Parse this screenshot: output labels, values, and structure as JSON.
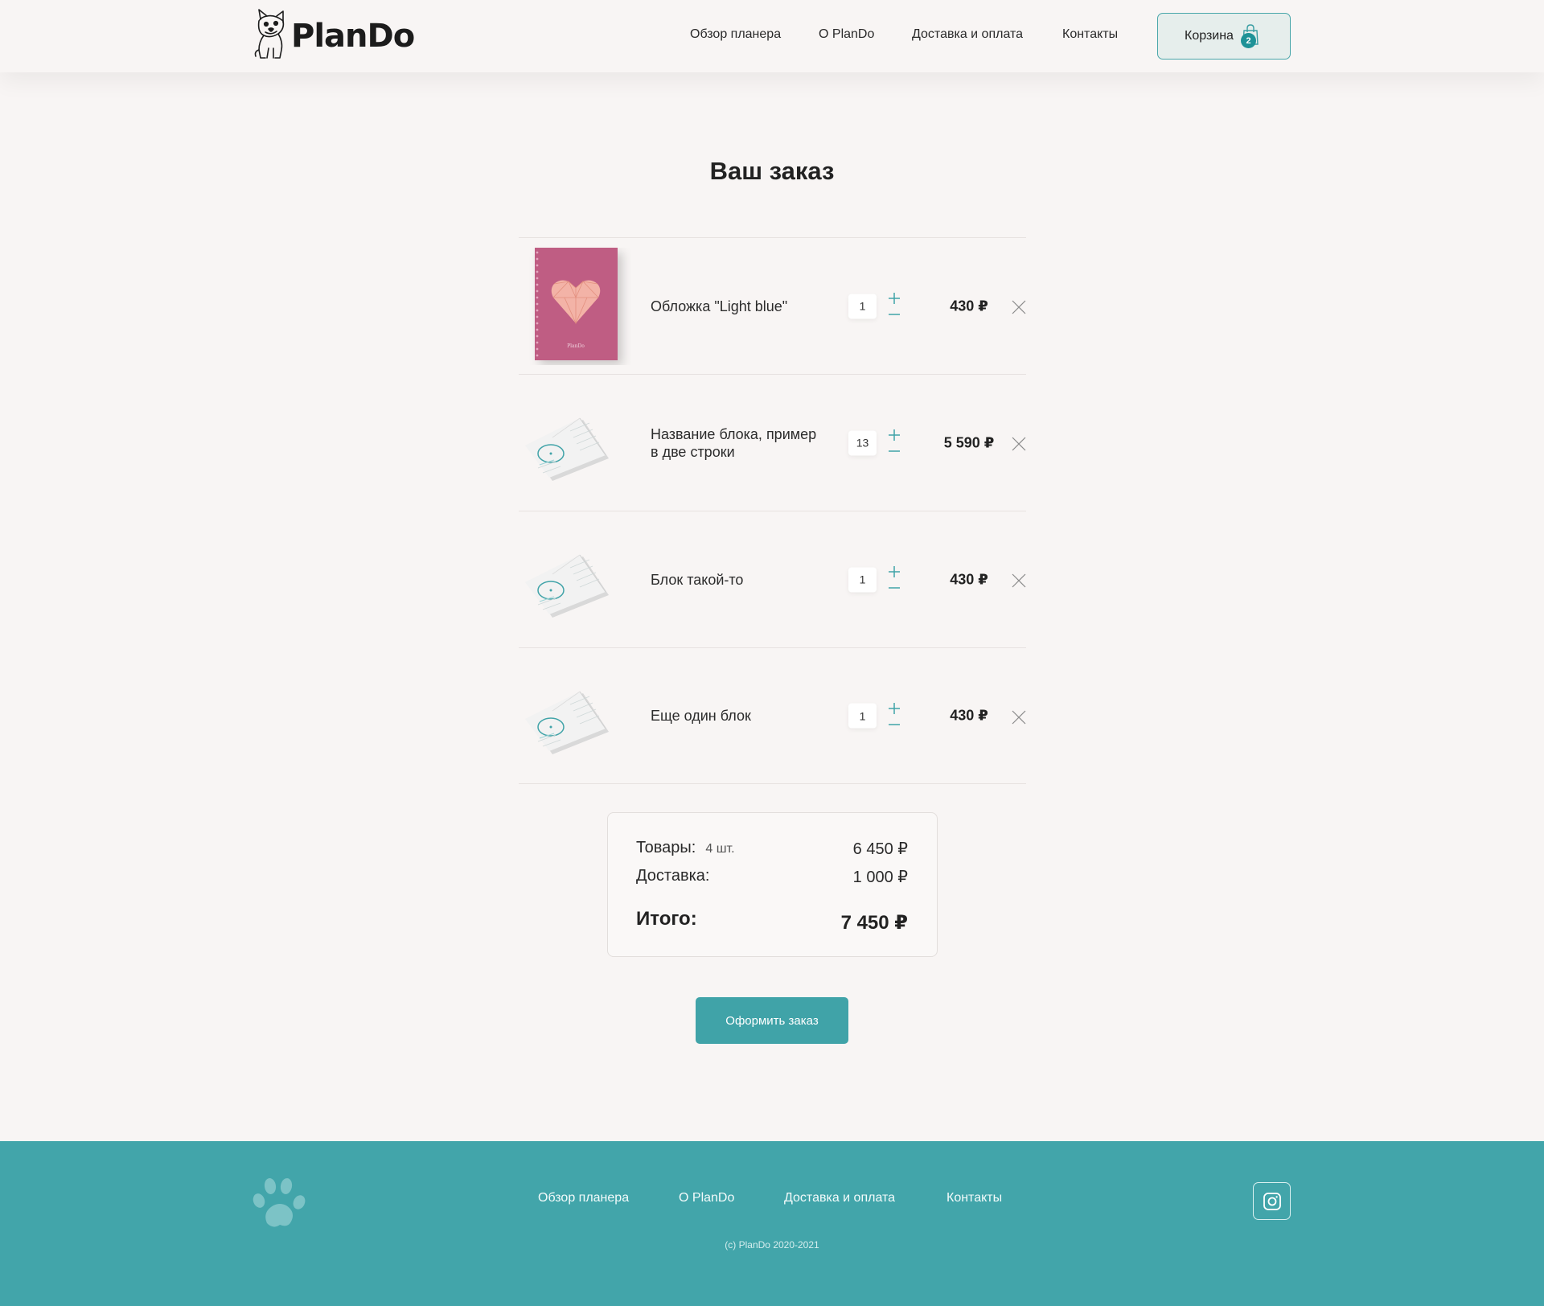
{
  "brand": {
    "name": "PlanDo"
  },
  "nav": [
    {
      "label": "Обзор планера"
    },
    {
      "label": "О PlanDo"
    },
    {
      "label": "Доставка и оплата"
    },
    {
      "label": "Контакты"
    }
  ],
  "cart": {
    "label": "Корзина",
    "count": "2"
  },
  "page": {
    "title": "Ваш заказ"
  },
  "items": [
    {
      "name": "Обложка \"Light blue\"",
      "qty": "1",
      "price": "430 ₽",
      "image": "pink-cover-heart"
    },
    {
      "name": "Название блока, пример в две строки",
      "qty": "13",
      "price": "5 590 ₽",
      "image": "open-planner-block"
    },
    {
      "name": "Блок такой-то",
      "qty": "1",
      "price": "430 ₽",
      "image": "open-planner-block"
    },
    {
      "name": "Еще один блок",
      "qty": "1",
      "price": "430 ₽",
      "image": "open-planner-block"
    }
  ],
  "summary": {
    "goods_label": "Товары:",
    "goods_count": "4 шт.",
    "goods_value": "6 450 ₽",
    "delivery_label": "Доставка:",
    "delivery_value": "1 000 ₽",
    "total_label": "Итого:",
    "total_value": "7 450 ₽"
  },
  "checkout": {
    "label": "Оформить заказ"
  },
  "footer": {
    "nav": [
      {
        "label": "Обзор планера"
      },
      {
        "label": "О PlanDo"
      },
      {
        "label": "Доставка и оплата"
      },
      {
        "label": "Контакты"
      }
    ],
    "copyright": "(c) PlanDo 2020-2021"
  },
  "icons": {
    "plus": "plus-icon",
    "minus": "minus-icon",
    "remove": "close-icon",
    "cart": "shopping-bag-icon",
    "social": "instagram-icon",
    "footer_logo": "paw-icon"
  },
  "colors": {
    "accent": "#40a3a8",
    "footer": "#42a5aa",
    "background": "#f8f5f4",
    "cover": "#bf5d83"
  }
}
